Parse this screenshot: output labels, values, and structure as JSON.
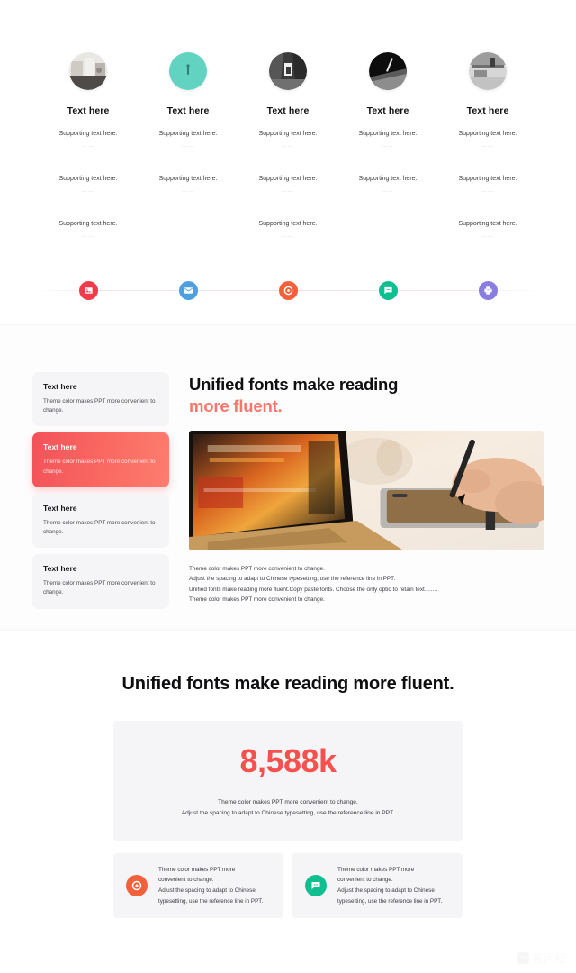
{
  "section_one": {
    "watermark": "",
    "columns": [
      {
        "title": "Text here",
        "circle_color": "#b9b6b2",
        "photo": "desk-scene",
        "rows": [
          {
            "text": "Supporting text here.",
            "dots": "……"
          },
          {
            "text": "Supporting text here.",
            "dots": "……"
          },
          {
            "text": "Supporting text here.",
            "dots": "……"
          }
        ]
      },
      {
        "title": "Text here",
        "circle_color": "#5ecfbc",
        "photo": "teal-scene",
        "rows": [
          {
            "text": "Supporting text here.",
            "dots": "……"
          },
          {
            "text": "Supporting text here.",
            "dots": "……"
          },
          {
            "text": "",
            "dots": ""
          }
        ]
      },
      {
        "title": "Text here",
        "circle_color": "#4a4a4a",
        "photo": "dark-door-scene",
        "rows": [
          {
            "text": "Supporting text here.",
            "dots": "……"
          },
          {
            "text": "Supporting text here.",
            "dots": "……"
          },
          {
            "text": "Supporting text here.",
            "dots": "……"
          }
        ]
      },
      {
        "title": "Text here",
        "circle_color": "#1b1b1b",
        "photo": "dark-pen-scene",
        "rows": [
          {
            "text": "Supporting text here.",
            "dots": "……"
          },
          {
            "text": "Supporting text here.",
            "dots": "……"
          },
          {
            "text": "",
            "dots": ""
          }
        ]
      },
      {
        "title": "Text here",
        "circle_color": "#9a9a9a",
        "photo": "gray-office-scene",
        "rows": [
          {
            "text": "Supporting text here.",
            "dots": "……"
          },
          {
            "text": "Supporting text here.",
            "dots": "……"
          },
          {
            "text": "Supporting text here.",
            "dots": "……"
          }
        ]
      }
    ],
    "rail_icons": [
      {
        "name": "image-icon",
        "color": "#ef3b4a"
      },
      {
        "name": "mail-icon",
        "color": "#4e9fe0"
      },
      {
        "name": "location-icon",
        "color": "#f4603c"
      },
      {
        "name": "chat-icon",
        "color": "#0fbf8f"
      },
      {
        "name": "printer-icon",
        "color": "#8a7de0"
      }
    ]
  },
  "section_two": {
    "watermark": "",
    "cards": [
      {
        "title": "Text here",
        "body": "Theme  color makes PPT more convenient to change.",
        "active": false
      },
      {
        "title": "Text here",
        "body": "Theme  color makes PPT more convenient to change.",
        "active": true
      },
      {
        "title": "Text here",
        "body": "Theme  color makes PPT more convenient to change.",
        "active": false
      },
      {
        "title": "Text here",
        "body": "Theme  color makes PPT more convenient to change.",
        "active": false
      }
    ],
    "heading_line1": "Unified fonts make reading",
    "heading_line2": "more fluent.",
    "accent_color": "#f8766b",
    "photo": "laptop-tablet-stylus",
    "paragraph_lines": [
      "Theme  color makes PPT more convenient to change.",
      "Adjust the spacing to adapt to Chinese typesetting, use the reference line in PPT.",
      "Unified fonts make reading more fluent.Copy paste fonts. Choose the only optio to retain text…….",
      "Theme  color makes PPT more convenient to change."
    ]
  },
  "section_three": {
    "heading": "Unified fonts make reading more fluent.",
    "stat_number": "8,588k",
    "stat_number_color": "#f4514f",
    "stat_sub_lines": [
      "Theme  color makes PPT more convenient to change.",
      "Adjust the spacing to adapt to Chinese typesetting, use the reference line in PPT."
    ],
    "bottom_cards": [
      {
        "icon": "location-icon",
        "color": "#f4603c",
        "lines": [
          "Theme  color makes PPT more",
          "convenient to change.",
          "Adjust the spacing to adapt to Chinese",
          "typesetting, use the reference line in PPT."
        ]
      },
      {
        "icon": "chat-icon",
        "color": "#0fbf8f",
        "lines": [
          "Theme  color makes PPT more",
          "convenient to change.",
          "Adjust the spacing to adapt to Chinese",
          "typesetting, use the reference line in PPT."
        ]
      }
    ],
    "watermark_text": "答问经"
  }
}
